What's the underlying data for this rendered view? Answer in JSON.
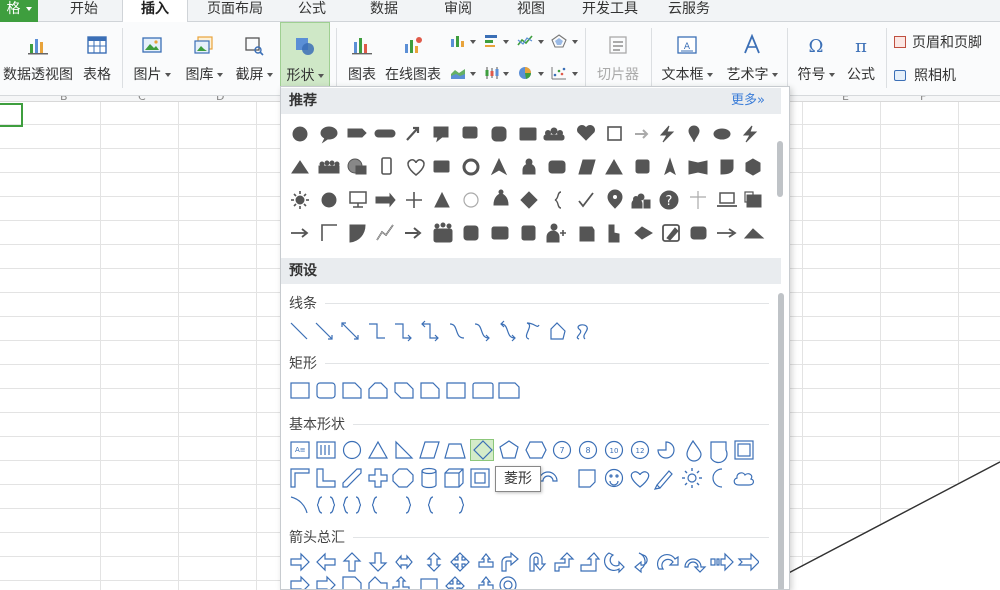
{
  "tabs": [
    {
      "id": "file",
      "label": "格"
    },
    {
      "id": "home",
      "label": "开始"
    },
    {
      "id": "insert",
      "label": "插入"
    },
    {
      "id": "layout",
      "label": "页面布局"
    },
    {
      "id": "formula",
      "label": "公式"
    },
    {
      "id": "data",
      "label": "数据"
    },
    {
      "id": "review",
      "label": "审阅"
    },
    {
      "id": "view",
      "label": "视图"
    },
    {
      "id": "dev",
      "label": "开发工具"
    },
    {
      "id": "cloud",
      "label": "云服务"
    }
  ],
  "ribbon": {
    "pivot": "数据透视图",
    "table": "表格",
    "picture": "图片",
    "gallery": "图库",
    "screenshot": "截屏",
    "shapes": "形状",
    "chart": "图表",
    "online_chart": "在线图表",
    "slicer": "切片器",
    "textbox": "文本框",
    "wordart": "艺术字",
    "symbol": "符号",
    "equation": "公式",
    "header_footer": "页眉和页脚",
    "camera": "照相机"
  },
  "sheet": {
    "columns": [
      "B",
      "C",
      "D",
      "E",
      "F"
    ]
  },
  "panel": {
    "recommended": "推荐",
    "more": "更多»",
    "preset": "预设",
    "lines": "线条",
    "rect": "矩形",
    "basic": "基本形状",
    "arrows": "箭头总汇",
    "tooltip": "菱形"
  },
  "colors": {
    "accent_green": "#3e9e3e",
    "selected_bg": "#cfe8c7",
    "shape_outline": "#3b6fb6",
    "icon_dark": "#555555"
  }
}
